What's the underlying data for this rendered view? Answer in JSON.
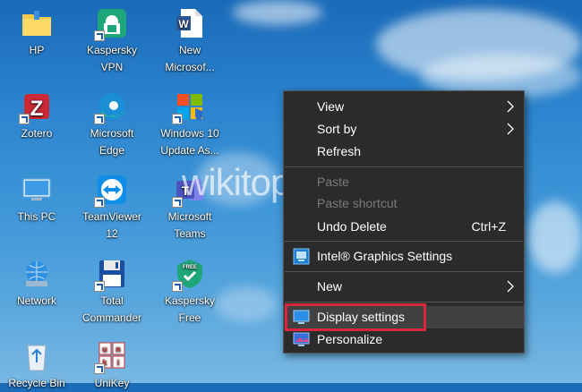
{
  "desktop": {
    "icons": [
      {
        "lines": [
          "HP",
          ""
        ]
      },
      {
        "lines": [
          "Kaspersky",
          "VPN"
        ]
      },
      {
        "lines": [
          "New",
          "Microsof..."
        ]
      },
      {
        "lines": [
          "Zotero",
          ""
        ]
      },
      {
        "lines": [
          "Microsoft",
          "Edge"
        ]
      },
      {
        "lines": [
          "Windows 10",
          "Update As..."
        ]
      },
      {
        "lines": [
          "This PC",
          ""
        ]
      },
      {
        "lines": [
          "TeamViewer",
          "12"
        ]
      },
      {
        "lines": [
          "Microsoft",
          "Teams"
        ]
      },
      {
        "lines": [
          "Network",
          ""
        ]
      },
      {
        "lines": [
          "Total",
          "Commander"
        ]
      },
      {
        "lines": [
          "Kaspersky",
          "Free"
        ]
      },
      {
        "lines": [
          "Recycle Bin",
          ""
        ]
      },
      {
        "lines": [
          "UniKey",
          ""
        ]
      }
    ]
  },
  "context_menu": {
    "view": "View",
    "sort_by": "Sort by",
    "refresh": "Refresh",
    "paste": "Paste",
    "paste_shortcut": "Paste shortcut",
    "undo_delete": "Undo Delete",
    "undo_delete_shortcut": "Ctrl+Z",
    "intel_graphics": "Intel® Graphics Settings",
    "new": "New",
    "display_settings": "Display settings",
    "personalize": "Personalize"
  },
  "watermark": "wikitop.vn",
  "colors": {
    "menu_bg": "#2b2b2b",
    "menu_hover": "#414141",
    "highlight": "#d7263d"
  }
}
